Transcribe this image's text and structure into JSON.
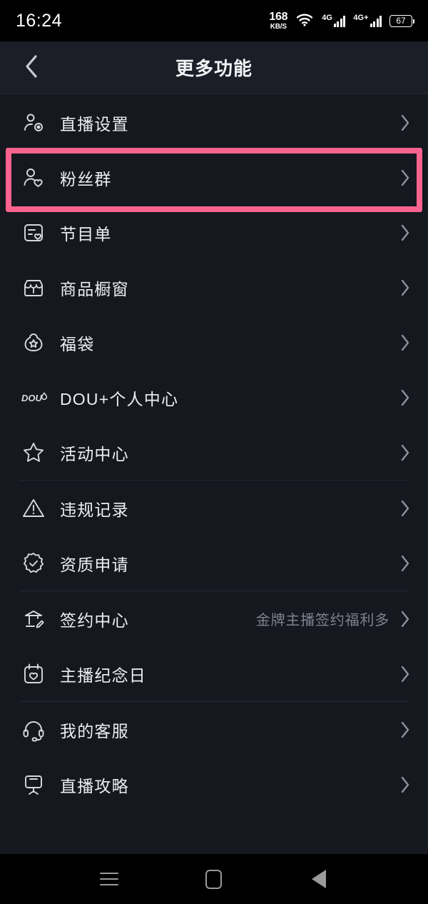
{
  "status_bar": {
    "time": "16:24",
    "net_speed": "168",
    "net_unit": "KB/S",
    "wifi_icon": "wifi-icon",
    "signal_1": "4G",
    "signal_2": "4G+",
    "battery": "67"
  },
  "header": {
    "back_icon": "chevron-left-icon",
    "title": "更多功能"
  },
  "highlight": {
    "color": "#f9638f",
    "target": "粉丝群"
  },
  "menu_groups": [
    {
      "items": [
        {
          "label": "直播设置",
          "icon": "person-gear-icon",
          "sub": "",
          "chevron": "chevron-right-icon"
        },
        {
          "label": "粉丝群",
          "icon": "person-heart-icon",
          "sub": "",
          "chevron": "chevron-right-icon"
        },
        {
          "label": "节目单",
          "icon": "list-heart-icon",
          "sub": "",
          "chevron": "chevron-right-icon"
        },
        {
          "label": "商品橱窗",
          "icon": "storefront-icon",
          "sub": "",
          "chevron": "chevron-right-icon"
        },
        {
          "label": "福袋",
          "icon": "lucky-bag-star-icon",
          "sub": "",
          "chevron": "chevron-right-icon"
        },
        {
          "label": "DOU+个人中心",
          "icon": "douplus-icon",
          "sub": "",
          "chevron": "chevron-right-icon"
        },
        {
          "label": "活动中心",
          "icon": "star-icon",
          "sub": "",
          "chevron": "chevron-right-icon"
        }
      ]
    },
    {
      "items": [
        {
          "label": "违规记录",
          "icon": "warning-triangle-icon",
          "sub": "",
          "chevron": "chevron-right-icon"
        },
        {
          "label": "资质申请",
          "icon": "verified-badge-icon",
          "sub": "",
          "chevron": "chevron-right-icon"
        }
      ]
    },
    {
      "items": [
        {
          "label": "签约中心",
          "icon": "contract-pencil-icon",
          "sub": "金牌主播签约福利多",
          "chevron": "chevron-right-icon"
        },
        {
          "label": "主播纪念日",
          "icon": "calendar-heart-icon",
          "sub": "",
          "chevron": "chevron-right-icon"
        }
      ]
    },
    {
      "items": [
        {
          "label": "我的客服",
          "icon": "headset-icon",
          "sub": "",
          "chevron": "chevron-right-icon"
        },
        {
          "label": "直播攻略",
          "icon": "easel-board-icon",
          "sub": "",
          "chevron": "chevron-right-icon"
        }
      ]
    }
  ],
  "nav_bar": {
    "recents": "menu-lines-icon",
    "home": "square-icon",
    "back": "triangle-back-icon"
  }
}
